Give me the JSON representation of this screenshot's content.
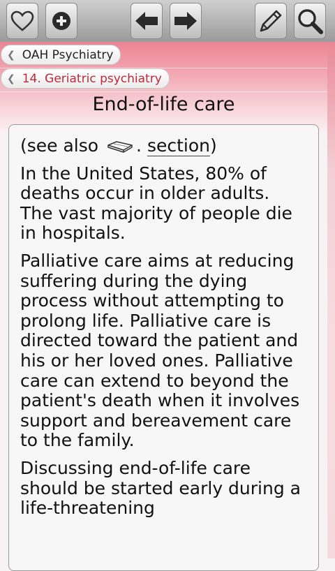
{
  "toolbar": {
    "buttons": [
      {
        "name": "favorites-button",
        "icon": "heart-icon"
      },
      {
        "name": "add-button",
        "icon": "plus-circle-icon"
      },
      {
        "name": "back-button",
        "icon": "arrow-left-icon"
      },
      {
        "name": "forward-button",
        "icon": "arrow-right-icon"
      },
      {
        "name": "edit-button",
        "icon": "pencil-icon"
      },
      {
        "name": "search-button",
        "icon": "magnifier-icon"
      }
    ]
  },
  "breadcrumbs": [
    {
      "label": "OAH Psychiatry"
    },
    {
      "label": "14. Geriatric psychiatry"
    }
  ],
  "page": {
    "title": "End-of-life care"
  },
  "content": {
    "see_also_prefix": "(see also",
    "see_also_mid": ".",
    "see_also_link": "section",
    "see_also_suffix": ")",
    "paragraphs": [
      "In the United States, 80% of deaths occur in older adults. The vast majority of people die in hospitals.",
      "Palliative care aims at reducing suffering during the dying process without attempting to prolong life. Palliative care is directed toward the patient and his or her loved ones. Palliative care can extend to beyond the patient's death when it involves support and bereavement care to the family.",
      "Discussing end-of-life care should be started early during a life-threatening"
    ]
  },
  "colors": {
    "header_accent": "#ed8595",
    "breadcrumb_active": "#c0283a"
  }
}
